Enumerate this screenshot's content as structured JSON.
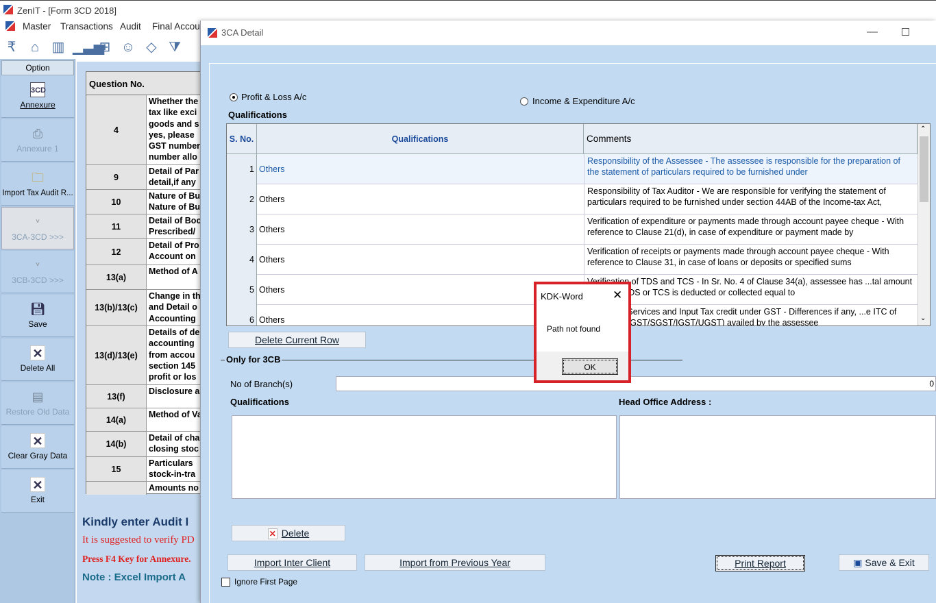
{
  "app": {
    "title": "ZenIT - [Form 3CD 2018]"
  },
  "menu": [
    "Master",
    "Transactions",
    "Audit",
    "Final Accou"
  ],
  "toolbar_icons": [
    "rupee-icon",
    "home-icon",
    "building-icon",
    "bar-chart-icon",
    "gift-icon",
    "users-icon",
    "tag-icon",
    "filter-icon"
  ],
  "sidebar": {
    "header": "Option",
    "items": [
      {
        "label": "Annexure",
        "icon": "3cd-icon",
        "enabled": true
      },
      {
        "label": "Annexure 1",
        "icon": "printer-icon",
        "enabled": false
      },
      {
        "label": "Import Tax Audit R...",
        "icon": "folder-add-icon",
        "enabled": true
      },
      {
        "label": "3CA-3CD >>>",
        "icon": "chevron-icon",
        "enabled": false,
        "selected": true
      },
      {
        "label": "3CB-3CD >>>",
        "icon": "chevron-icon",
        "enabled": false
      },
      {
        "label": "Save",
        "icon": "save-icon",
        "enabled": true
      },
      {
        "label": "Delete All",
        "icon": "x-icon",
        "enabled": true
      },
      {
        "label": "Restore Old Data",
        "icon": "document-icon",
        "enabled": false
      },
      {
        "label": "Clear Gray Data",
        "icon": "x-icon",
        "enabled": true
      },
      {
        "label": "Exit",
        "icon": "x-icon",
        "enabled": true
      }
    ]
  },
  "bg_grid": {
    "header": "Question No.",
    "rows": [
      {
        "q": "4",
        "d": "Whether the\ntax like exci\ngoods and s\nyes, please\nGST number\nnumber allo"
      },
      {
        "q": "9",
        "d": "Detail of Par\ndetail,if any"
      },
      {
        "q": "10",
        "d": "Nature of Bu\nNature of Bu"
      },
      {
        "q": "11",
        "d": "Detail of Boo\nPrescribed/"
      },
      {
        "q": "12",
        "d": "Detail of Pro\nAccount on"
      },
      {
        "q": "13(a)",
        "d": "Method of A"
      },
      {
        "q": "13(b)/13(c)",
        "d": "Change in th\nand Detail o\nAccounting"
      },
      {
        "q": "13(d)/13(e)",
        "d": "Details of de\naccounting\nfrom accou\nsection 145\nprofit or los"
      },
      {
        "q": "13(f)",
        "d": "Disclosure a"
      },
      {
        "q": "14(a)",
        "d": "Method of Va"
      },
      {
        "q": "14(b)",
        "d": "Detail of cha\nclosing stoc"
      },
      {
        "q": "15",
        "d": "Particulars\nstock-in-tra"
      },
      {
        "q": "",
        "d": "Amounts no"
      }
    ]
  },
  "footer": {
    "kindly": "Kindly enter Audit I",
    "suggest": "It is suggested to verify PD",
    "press_f4": "Press F4 Key for Annexure.",
    "note": "Note : Excel Import A"
  },
  "dialog": {
    "title": "3CA Detail",
    "radio_pl": "Profit & Loss A/c",
    "radio_ie": "Income & Expenditure A/c",
    "qualifications_label": "Qualifications",
    "grid": {
      "col_sno": "S. No.",
      "col_qual": "Qualifications",
      "col_comments": "Comments",
      "rows": [
        {
          "n": "1",
          "q": "Others",
          "c": "Responsibility of the Assessee - The assessee is responsible for the preparation of the statement of particulars required to be furnished under"
        },
        {
          "n": "2",
          "q": "Others",
          "c": "Responsibility of Tax Auditor - We are responsible for verifying the statement of particulars required to be furnished under section 44AB of the Income-tax Act,"
        },
        {
          "n": "3",
          "q": "Others",
          "c": "Verification of expenditure or payments made through account payee cheque - With reference to Clause 21(d), in case of expenditure or payment made by"
        },
        {
          "n": "4",
          "q": "Others",
          "c": "Verification of receipts or payments made through account payee cheque - With reference to Clause 31, in case of loans or deposits or specified sums"
        },
        {
          "n": "5",
          "q": "Others",
          "c": "Verification of TDS and TCS - In Sr. No. 4 of Clause 34(a), assessee has ...tal amount on which TDS or TCS is deducted or collected equal to"
        },
        {
          "n": "6",
          "q": "Others",
          "c": "...ods and Services and Input Tax credit under GST - Differences if any, ...e ITC of GST (i.e. CGST/SGST/IGST/UGST) availed by the assessee"
        }
      ]
    },
    "delete_row": "Delete Current Row",
    "only3cb": "Only for 3CB",
    "branches_label": "No of Branch(s)",
    "branches_value": "0",
    "qual2_label": "Qualifications",
    "head_office_label": "Head Office Address :",
    "delete": "Delete",
    "import_inter": "Import Inter Client",
    "import_prev": "Import from Previous Year",
    "print_report": "Print Report",
    "save_exit": "Save & Exit",
    "ignore_first": "Ignore First Page"
  },
  "alert": {
    "title": "KDK-Word",
    "message": "Path not found",
    "ok": "OK"
  },
  "colors": {
    "dialog_bg": "#c3dbf2",
    "sidebar_bg": "#aec8e4",
    "highlight": "#d8222a"
  }
}
